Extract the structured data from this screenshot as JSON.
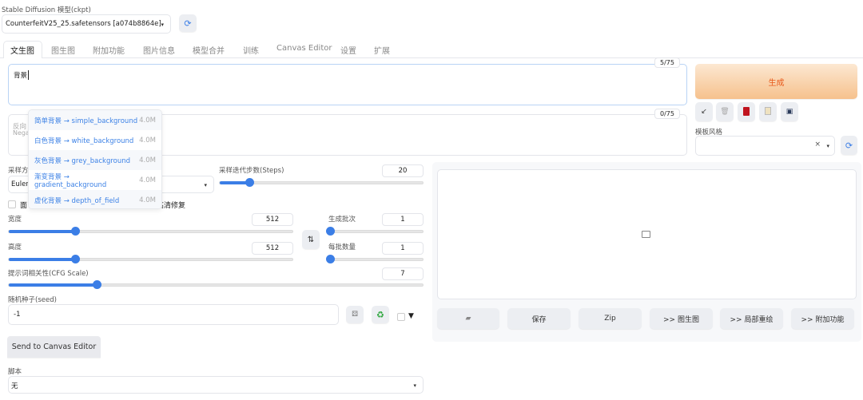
{
  "model": {
    "label": "Stable Diffusion 模型(ckpt)",
    "value": "CounterfeitV25_25.safetensors [a074b8864e]"
  },
  "tabs": [
    "文生图",
    "图生图",
    "附加功能",
    "图片信息",
    "模型合并",
    "训练",
    "Canvas Editor",
    "设置",
    "扩展"
  ],
  "prompt": {
    "value": "背景",
    "counter": "5/75"
  },
  "negative": {
    "placeholder_line1": "反向",
    "placeholder_line2": "Nega",
    "counter": "0/75"
  },
  "autocomplete": [
    {
      "text": "简单背景 → simple_background",
      "size": "4.0M"
    },
    {
      "text": "白色背景 → white_background",
      "size": "4.0M"
    },
    {
      "text": "灰色背景 → grey_background",
      "size": "4.0M"
    },
    {
      "text": "渐变背景 → gradient_background",
      "size": "4.0M"
    },
    {
      "text": "虚化背景 → depth_of_field",
      "size": "4.0M"
    }
  ],
  "generate": {
    "label": "生成",
    "color": "#e8591a"
  },
  "style": {
    "label": "模板风格",
    "clear": "×"
  },
  "sampler": {
    "label": "采样方",
    "value": "Euler"
  },
  "steps": {
    "label": "采样迭代步数(Steps)",
    "value": "20",
    "fraction": 0.14
  },
  "checks": {
    "face": "面",
    "hires": "高清修复"
  },
  "width": {
    "label": "宽度",
    "value": "512",
    "fraction": 0.23
  },
  "height": {
    "label": "高度",
    "value": "512",
    "fraction": 0.23
  },
  "batch_count": {
    "label": "生成批次",
    "value": "1",
    "fraction": 0.0
  },
  "batch_size": {
    "label": "每批数量",
    "value": "1",
    "fraction": 0.0
  },
  "cfg": {
    "label": "提示词相关性(CFG Scale)",
    "value": "7",
    "fraction": 0.21
  },
  "seed": {
    "label": "随机种子(seed)",
    "value": "-1",
    "extra": "▼"
  },
  "canvas_btn": "Send to Canvas Editor",
  "script": {
    "label": "脚本",
    "value": "无"
  },
  "output_buttons": [
    "保存",
    "Zip",
    ">> 图生图",
    ">> 局部重绘",
    ">> 附加功能"
  ]
}
